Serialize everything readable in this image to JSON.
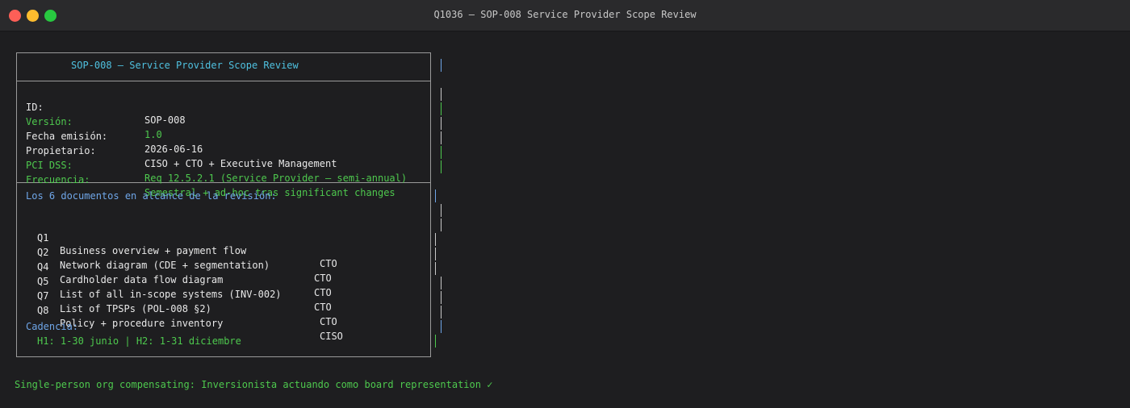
{
  "window": {
    "title": "Q1036 — SOP-008 Service Provider Scope Review"
  },
  "panel": {
    "header": "SOP-008 — Service Provider Scope Review",
    "fields": [
      {
        "label": "ID:",
        "value": "SOP-008"
      },
      {
        "label": "Versión:",
        "value": "1.0"
      },
      {
        "label": "Fecha emisión:",
        "value": "2026-06-16"
      },
      {
        "label": "Propietario:",
        "value": "CISO + CTO + Executive Management"
      },
      {
        "label": "PCI DSS:",
        "value": "Req 12.5.2.1 (Service Provider — semi-annual)"
      },
      {
        "label": "Frecuencia:",
        "value": "Semestral + ad-hoc tras significant changes"
      }
    ],
    "scope_heading": "Los 6 documentos en alcance de la revisión:",
    "documents": [
      {
        "id": "Q1",
        "description": "Business overview + payment flow",
        "owner": "CTO"
      },
      {
        "id": "Q2",
        "description": "Network diagram (CDE + segmentation)",
        "owner": "CTO"
      },
      {
        "id": "Q4",
        "description": "Cardholder data flow diagram",
        "owner": "CTO"
      },
      {
        "id": "Q5",
        "description": "List of all in-scope systems (INV-002)",
        "owner": "CTO"
      },
      {
        "id": "Q7",
        "description": "List of TPSPs (POL-008 §2)",
        "owner": "CTO"
      },
      {
        "id": "Q8",
        "description": "Policy + procedure inventory",
        "owner": "CISO"
      }
    ],
    "cadence_heading": "Cadencia:",
    "cadence_value": "H1: 1-30 junio | H2: 1-31 diciembre"
  },
  "footer": "Single-person org compensating: Inversionista actuando como board representation ✓",
  "colors": {
    "cyan": "#4fc1e0",
    "green": "#4ec94e",
    "blue": "#6fa6e8",
    "white": "#e8e8e8",
    "background": "#1e1e20",
    "titlebar": "#2a2a2c"
  }
}
